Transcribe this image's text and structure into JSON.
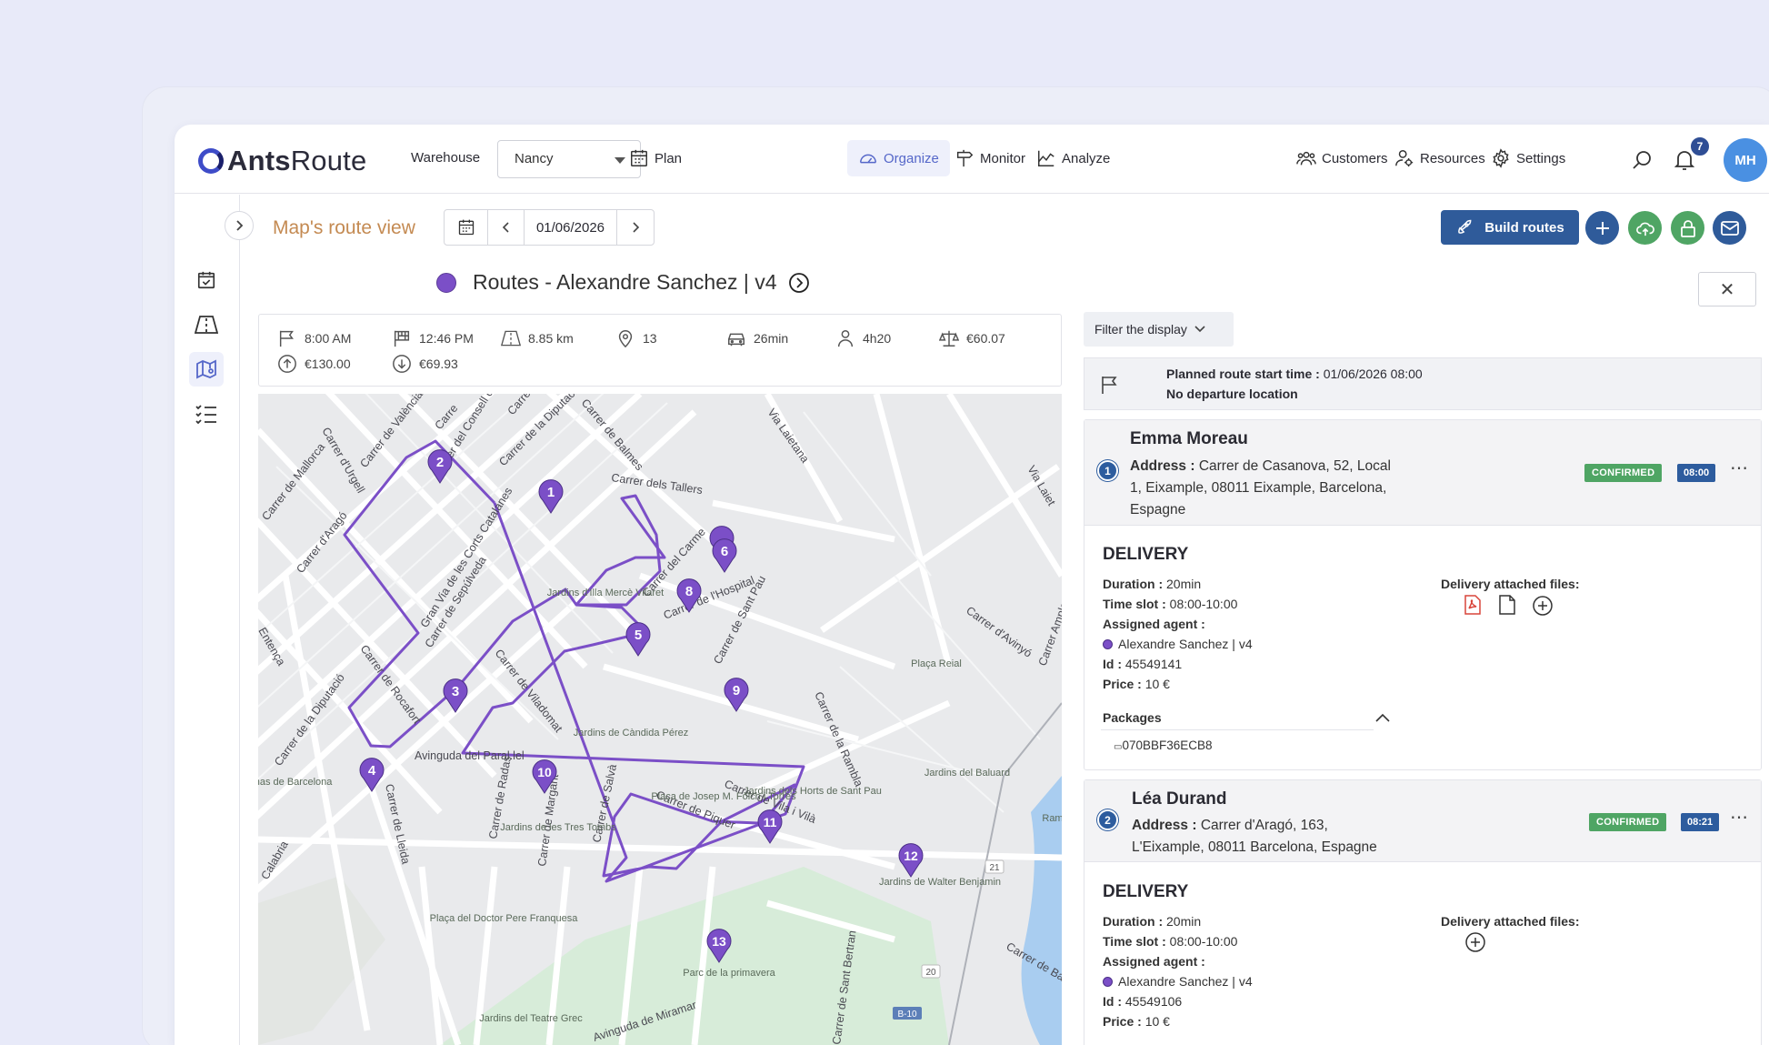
{
  "app": {
    "brand_bold": "Ants",
    "brand_light": "Route"
  },
  "topbar": {
    "warehouse_label": "Warehouse",
    "warehouse_value": "Nancy",
    "nav": [
      {
        "label": "Plan",
        "icon": "calendar-icon"
      },
      {
        "label": "Organize",
        "icon": "gauge-icon",
        "active": true
      },
      {
        "label": "Monitor",
        "icon": "signpost-icon"
      },
      {
        "label": "Analyze",
        "icon": "chart-icon"
      },
      {
        "label": "Customers",
        "icon": "customers-icon"
      },
      {
        "label": "Resources",
        "icon": "resources-icon"
      },
      {
        "label": "Settings",
        "icon": "gear-icon"
      }
    ],
    "notifications": "7",
    "avatar_initials": "MH"
  },
  "toolbar": {
    "page_title": "Map's route view",
    "date": "01/06/2026",
    "build_routes": "Build routes"
  },
  "route": {
    "title": "Routes - Alexandre Sanchez | v4",
    "color": "#7b4fc7",
    "stats": {
      "start_time": "8:00 AM",
      "end_time": "12:46 PM",
      "distance": "8.85 km",
      "stops": "13",
      "drive_time": "26min",
      "work_time": "4h20",
      "cost": "€60.07",
      "revenue": "€130.00",
      "expense": "€69.93"
    }
  },
  "map": {
    "streets": [
      "Carrer del Consell de Cent",
      "Carrer de la Diputació",
      "Carrer de Balmes",
      "Carrer dels Tallers",
      "Via Laietana",
      "Carrer de Mallorca",
      "Carrer de València",
      "Carrer d'Aragó",
      "Gran Via de les Corts Catalanes",
      "Carrer de Sepúlveda",
      "Carrer de Viladomat",
      "Carrer del Carme",
      "Carrer de l'Hospital",
      "Carrer de Sant Pau",
      "Avinguda del Paral.lel",
      "Carrer de Vila i Vilà",
      "Carrer de Piquer",
      "Carrer de Lleida",
      "Carrer de Radas",
      "Carrer de Margarit",
      "Carrer de Salvà",
      "Avinguda de Miramar",
      "Carrer de Rocafort",
      "Carrer de la Rambla",
      "Carrer d'Avinyó",
      "Carrer de Sant Bertran",
      "Carrer de Ba",
      "Via Laiet",
      "Carrer d'Urgell",
      "Entença",
      "Carrer Ample",
      "Calabria",
      "Carre",
      "Carre",
      "Carrer de la Diputació"
    ],
    "places": [
      "Jardins d'Illa Mercè Vilaret",
      "Jardins de Càndida Pérez",
      "Plaça de Josep M. Folch i Torres",
      "Jardins dels Horts de Sant Pau",
      "Jardins de les Tres Tombs",
      "Plaça del Doctor Pere Franquesa",
      "Jardins del Teatre Grec",
      "Parc de la primavera",
      "Jardins del Baluard",
      "Jardins de Walter Benjamin",
      "Plaça Reial",
      "Arenas de Barcelona",
      "Ram"
    ],
    "road_shields": [
      "B-10",
      "20",
      "21"
    ],
    "stops": [
      "1",
      "2",
      "3",
      "4",
      "5",
      "6",
      "8",
      "9",
      "10",
      "11",
      "12",
      "13"
    ]
  },
  "panel": {
    "filter_label": "Filter the display",
    "start_label": "Planned route start time :",
    "start_value": "01/06/2026 08:00",
    "no_departure": "No departure location",
    "cards": [
      {
        "num": "1",
        "name": "Emma Moreau",
        "address_label": "Address :",
        "address_line1": "Carrer de Casanova, 52, Local",
        "address_line2": "1, Eixample, 08011 Eixample, Barcelona,",
        "address_line3": "Espagne",
        "status": "CONFIRMED",
        "time": "08:00",
        "section": "DELIVERY",
        "duration": "20min",
        "time_slot": "08:00-10:00",
        "agent": "Alexandre Sanchez | v4",
        "id": "45549141",
        "price": "10 €",
        "files_label": "Delivery attached files:",
        "packages_label": "Packages",
        "package": "070BBF36ECB8"
      },
      {
        "num": "2",
        "name": "Léa Durand",
        "address_label": "Address :",
        "address_line1": "Carrer d'Aragó, 163,",
        "address_line2": "L'Eixample, 08011 Barcelona, Espagne",
        "status": "CONFIRMED",
        "time": "08:21",
        "section": "DELIVERY",
        "duration": "20min",
        "time_slot": "08:00-10:00",
        "agent": "Alexandre Sanchez | v4",
        "id": "45549106",
        "price": "10 €",
        "files_label": "Delivery attached files:"
      }
    ],
    "labels": {
      "duration": "Duration :",
      "time_slot": "Time slot :",
      "assigned_agent": "Assigned agent :",
      "id": "Id :",
      "price": "Price :"
    }
  }
}
